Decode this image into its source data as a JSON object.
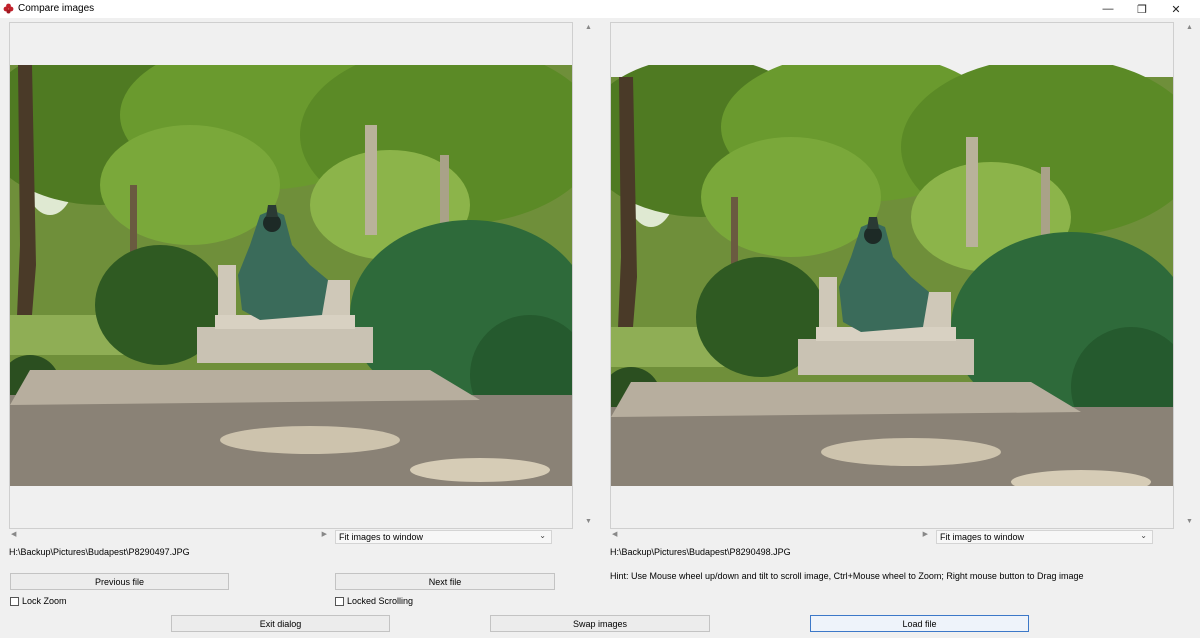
{
  "window": {
    "title": "Compare images",
    "app_icon": "red-flower-icon",
    "controls": {
      "minimize": "—",
      "restore": "❐",
      "close": "✕"
    }
  },
  "left": {
    "zoom_select": {
      "selected": "Fit images to window"
    },
    "file_path": "H:\\Backup\\Pictures\\Budapest\\P8290497.JPG",
    "photo_label": "Park statue photo"
  },
  "right": {
    "zoom_select": {
      "selected": "Fit images to window"
    },
    "file_path": "H:\\Backup\\Pictures\\Budapest\\P8290498.JPG",
    "photo_label": "Park statue photo"
  },
  "buttons": {
    "previous_file": "Previous file",
    "next_file": "Next file",
    "exit_dialog": "Exit dialog",
    "swap_images": "Swap images",
    "load_file": "Load file"
  },
  "checkboxes": {
    "lock_zoom": {
      "label": "Lock Zoom",
      "checked": false
    },
    "locked_scrolling": {
      "label": "Locked Scrolling",
      "checked": false
    }
  },
  "hint": "Hint: Use Mouse wheel up/down and tilt to scroll image, Ctrl+Mouse wheel to Zoom; Right mouse button to Drag image",
  "colors": {
    "default_button_border": "#3c78c8",
    "app_icon": "#c0202a"
  }
}
